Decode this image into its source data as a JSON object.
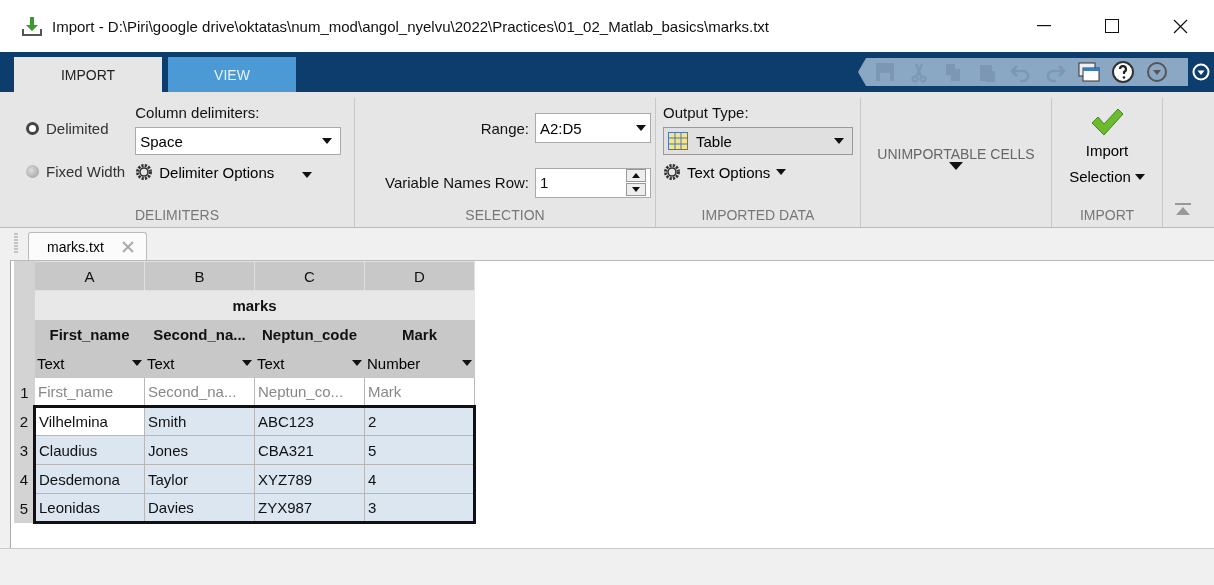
{
  "window": {
    "title": "Import - D:\\Piri\\google drive\\oktatas\\num_mod\\angol_nyelvu\\2022\\Practices\\01_02_Matlab_basics\\marks.txt"
  },
  "tabs": [
    {
      "label": "IMPORT",
      "selected": true
    },
    {
      "label": "VIEW",
      "selected": false
    }
  ],
  "quick_access": [
    {
      "kind": "save",
      "disabled": true
    },
    {
      "kind": "cut",
      "disabled": true
    },
    {
      "kind": "copy",
      "disabled": true
    },
    {
      "kind": "paste",
      "disabled": true
    },
    {
      "kind": "undo",
      "disabled": true
    },
    {
      "kind": "redo",
      "disabled": true
    },
    {
      "kind": "layout",
      "disabled": false
    },
    {
      "kind": "help",
      "disabled": false
    },
    {
      "kind": "more",
      "disabled": false
    }
  ],
  "ribbon": {
    "delimiters": {
      "radios": [
        {
          "label": "Delimited",
          "selected": true
        },
        {
          "label": "Fixed Width",
          "selected": false
        }
      ],
      "column_delimiters_label": "Column delimiters:",
      "column_delimiters_value": "Space",
      "options_button": "Delimiter Options",
      "section_label": "DELIMITERS"
    },
    "selection": {
      "range_label": "Range:",
      "range_value": "A2:D5",
      "names_row_label": "Variable Names Row:",
      "names_row_value": "1",
      "section_label": "SELECTION"
    },
    "imported_data": {
      "output_type_label": "Output Type:",
      "output_type_value": "Table",
      "options_button": "Text Options",
      "section_label": "IMPORTED DATA"
    },
    "unimportable": {
      "label": "UNIMPORTABLE CELLS"
    },
    "import": {
      "button_line_1": "Import",
      "button_line_2": "Selection",
      "section_label": "IMPORT"
    }
  },
  "document_tab": {
    "label": "marks.txt"
  },
  "table": {
    "column_letters": [
      "A",
      "B",
      "C",
      "D"
    ],
    "title": "marks",
    "columns": [
      {
        "name": "First_name",
        "type": "Text"
      },
      {
        "name": "Second_na...",
        "type": "Text"
      },
      {
        "name": "Neptun_code",
        "type": "Text"
      },
      {
        "name": "Mark",
        "type": "Number"
      }
    ],
    "rows": [
      {
        "number": "1",
        "kind": "names",
        "selected": false,
        "cells": [
          {
            "text": "First_name",
            "active": false
          },
          {
            "text": "Second_na...",
            "active": false
          },
          {
            "text": "Neptun_co...",
            "active": false
          },
          {
            "text": "Mark",
            "active": false
          }
        ]
      },
      {
        "number": "2",
        "kind": "data",
        "selected": true,
        "cells": [
          {
            "text": "Vilhelmina",
            "active": true
          },
          {
            "text": "Smith",
            "active": false
          },
          {
            "text": "ABC123",
            "active": false
          },
          {
            "text": "2",
            "active": false
          }
        ]
      },
      {
        "number": "3",
        "kind": "data",
        "selected": true,
        "cells": [
          {
            "text": "Claudius",
            "active": false
          },
          {
            "text": "Jones",
            "active": false
          },
          {
            "text": "CBA321",
            "active": false
          },
          {
            "text": "5",
            "active": false
          }
        ]
      },
      {
        "number": "4",
        "kind": "data",
        "selected": true,
        "cells": [
          {
            "text": "Desdemona",
            "active": false
          },
          {
            "text": "Taylor",
            "active": false
          },
          {
            "text": "XYZ789",
            "active": false
          },
          {
            "text": "4",
            "active": false
          }
        ]
      },
      {
        "number": "5",
        "kind": "data",
        "selected": true,
        "cells": [
          {
            "text": "Leonidas",
            "active": false
          },
          {
            "text": "Davies",
            "active": false
          },
          {
            "text": "ZYX987",
            "active": false
          },
          {
            "text": "3",
            "active": false
          }
        ]
      }
    ]
  }
}
